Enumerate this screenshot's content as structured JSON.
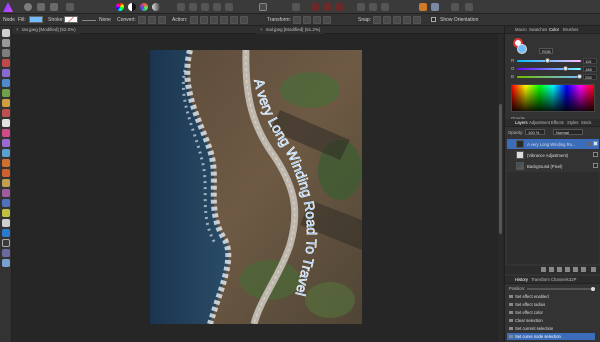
{
  "context": {
    "mode": "Node",
    "fill_label": "Fill:",
    "stroke_label": "Stroke:",
    "stroke_value": "None",
    "convert_label": "Convert:",
    "action_label": "Action:",
    "transform_label": "Transform:",
    "snap_label": "Snap:",
    "show_orientation_label": "Show Orientation"
  },
  "tabs": [
    {
      "label": "ran.jpeg [Modified] (52.0%)"
    },
    {
      "label": "mal.jpeg [Modified] (51.2%)"
    }
  ],
  "canvas": {
    "path_text": "A very Long Winding Road To Travel"
  },
  "color_panel": {
    "tabs": [
      "Macro",
      "Swatches",
      "Color",
      "Brushes"
    ],
    "active_tab": "Color",
    "mode": "RGB",
    "channels": [
      {
        "label": "R",
        "value": "115"
      },
      {
        "label": "G",
        "value": "188"
      },
      {
        "label": "B",
        "value": "255"
      }
    ],
    "opacity_label": "Opacity",
    "accent": "#73BCFF"
  },
  "layers_panel": {
    "tabs": [
      "Layers",
      "Adjustment",
      "Effects",
      "Styles",
      "Stock"
    ],
    "opacity_label": "Opacity:",
    "opacity_value": "100 %",
    "blend_mode": "Normal",
    "layers": [
      {
        "name": "A very Long Winding Ro...",
        "selected": true
      },
      {
        "name": "(Vibrance Adjustment)",
        "selected": false
      },
      {
        "name": "Background (Pixel)",
        "selected": false
      }
    ]
  },
  "history_panel": {
    "tabs": [
      "History",
      "Transform",
      "Channels",
      "32P"
    ],
    "position_label": "Position:",
    "items": [
      {
        "label": "Set effect enabled",
        "selected": false
      },
      {
        "label": "Set effect radius",
        "selected": false
      },
      {
        "label": "Set effect color",
        "selected": false
      },
      {
        "label": "Clear selection",
        "selected": false
      },
      {
        "label": "Set current selection",
        "selected": false
      },
      {
        "label": "Set curve node selection",
        "selected": true
      }
    ]
  }
}
